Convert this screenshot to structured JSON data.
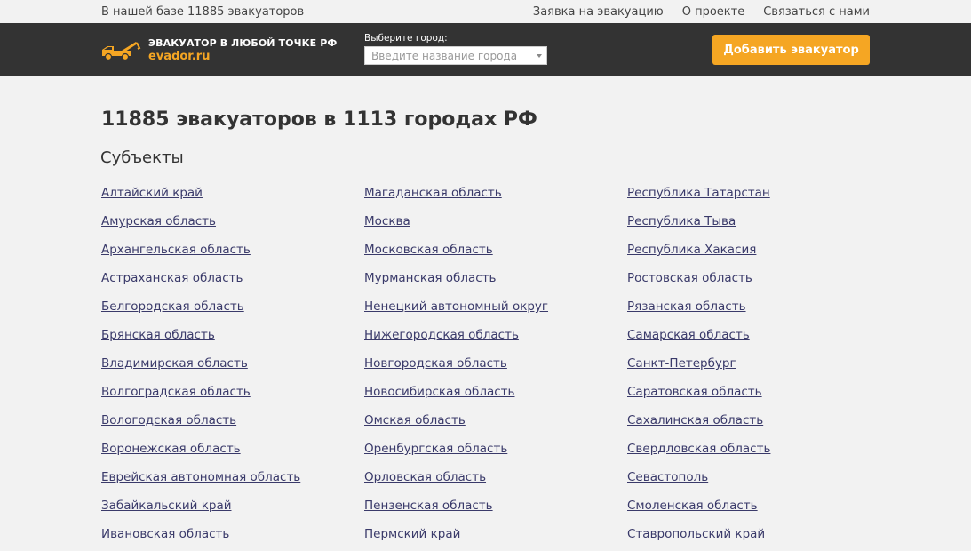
{
  "topbar": {
    "base_info": "В нашей базе 11885 эвакуаторов",
    "links": [
      "Заявка на эвакуацию",
      "О проекте",
      "Связаться с нами"
    ]
  },
  "header": {
    "logo_title": "ЭВАКУАТОР В ЛЮБОЙ ТОЧКЕ РФ",
    "logo_domain": "evador.ru",
    "city_label": "Выберите город:",
    "city_placeholder": "Введите название города",
    "add_button": "Добавить эвакуатор"
  },
  "colors": {
    "accent": "#f5a623",
    "header_bg": "#333333",
    "link": "#3a3a6a"
  },
  "main": {
    "title": "11885 эвакуаторов в 1113 городах РФ",
    "subtitle": "Субъекты",
    "columns": [
      [
        "Алтайский край",
        "Амурская область",
        "Архангельская область",
        "Астраханская область",
        "Белгородская область",
        "Брянская область",
        "Владимирская область",
        "Волгоградская область",
        "Вологодская область",
        "Воронежская область",
        "Еврейская автономная область",
        "Забайкальский край",
        "Ивановская область"
      ],
      [
        "Магаданская область",
        "Москва",
        "Московская область",
        "Мурманская область",
        "Ненецкий автономный округ",
        "Нижегородская область",
        "Новгородская область",
        "Новосибирская область",
        "Омская область",
        "Оренбургская область",
        "Орловская область",
        "Пензенская область",
        "Пермский край"
      ],
      [
        "Республика Татарстан",
        "Республика Тыва",
        "Республика Хакасия",
        "Ростовская область",
        "Рязанская область",
        "Самарская область",
        "Санкт-Петербург",
        "Саратовская область",
        "Сахалинская область",
        "Свердловская область",
        "Севастополь",
        "Смоленская область",
        "Ставропольский край"
      ]
    ]
  }
}
